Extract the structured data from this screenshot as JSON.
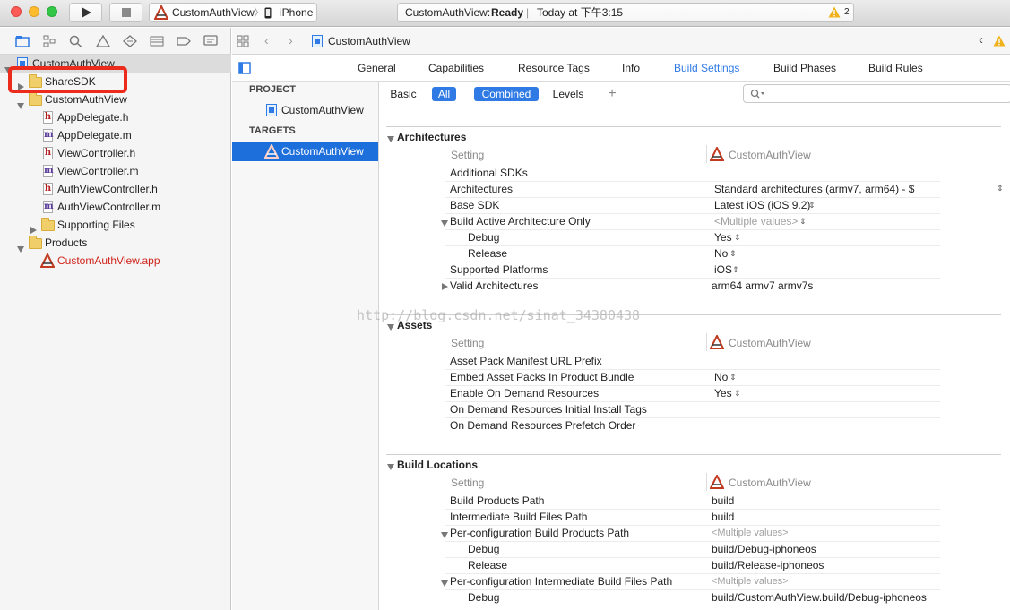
{
  "toolbar": {
    "scheme_name": "CustomAuthView",
    "device": "iPhone",
    "activity_project": "CustomAuthView:",
    "activity_status": "Ready",
    "activity_separator": "|",
    "activity_time": "Today at 下午3:15",
    "warning_count": "2"
  },
  "navigator": {
    "items": [
      {
        "label": "CustomAuthView"
      },
      {
        "label": "ShareSDK"
      },
      {
        "label": "CustomAuthView"
      },
      {
        "label": "AppDelegate.h",
        "type": "h"
      },
      {
        "label": "AppDelegate.m",
        "type": "m"
      },
      {
        "label": "ViewController.h",
        "type": "h"
      },
      {
        "label": "ViewController.m",
        "type": "m"
      },
      {
        "label": "AuthViewController.h",
        "type": "h"
      },
      {
        "label": "AuthViewController.m",
        "type": "m"
      },
      {
        "label": "Supporting Files"
      },
      {
        "label": "Products"
      },
      {
        "label": "CustomAuthView.app"
      }
    ]
  },
  "jumpbar": {
    "file": "CustomAuthView"
  },
  "project_tabs": [
    "General",
    "Capabilities",
    "Resource Tags",
    "Info",
    "Build Settings",
    "Build Phases",
    "Build Rules"
  ],
  "targets_pane": {
    "project_header": "PROJECT",
    "project_item": "CustomAuthView",
    "targets_header": "TARGETS",
    "target_item": "CustomAuthView"
  },
  "filter": {
    "basic": "Basic",
    "all": "All",
    "combined": "Combined",
    "levels": "Levels",
    "add": "+"
  },
  "sections": {
    "architectures": {
      "title": "Architectures",
      "col_setting": "Setting",
      "col_target": "CustomAuthView",
      "rows": [
        {
          "name": "Additional SDKs",
          "value": ""
        },
        {
          "name": "Architectures",
          "value": "Standard architectures (armv7, arm64)  -  $"
        },
        {
          "name": "Base SDK",
          "value": "Latest iOS (iOS 9.2)"
        },
        {
          "name": "Build Active Architecture Only",
          "value": "<Multiple values>"
        },
        {
          "name": "Debug",
          "value": "Yes"
        },
        {
          "name": "Release",
          "value": "No"
        },
        {
          "name": "Supported Platforms",
          "value": "iOS"
        },
        {
          "name": "Valid Architectures",
          "value": "arm64 armv7 armv7s"
        }
      ]
    },
    "assets": {
      "title": "Assets",
      "col_setting": "Setting",
      "col_target": "CustomAuthView",
      "rows": [
        {
          "name": "Asset Pack Manifest URL Prefix",
          "value": ""
        },
        {
          "name": "Embed Asset Packs In Product Bundle",
          "value": "No"
        },
        {
          "name": "Enable On Demand Resources",
          "value": "Yes"
        },
        {
          "name": "On Demand Resources Initial Install Tags",
          "value": ""
        },
        {
          "name": "On Demand Resources Prefetch Order",
          "value": ""
        }
      ]
    },
    "build_locations": {
      "title": "Build Locations",
      "col_setting": "Setting",
      "col_target": "CustomAuthView",
      "rows": [
        {
          "name": "Build Products Path",
          "value": "build"
        },
        {
          "name": "Intermediate Build Files Path",
          "value": "build"
        },
        {
          "name": "Per-configuration Build Products Path",
          "value": "<Multiple values>"
        },
        {
          "name": "Debug",
          "value": "build/Debug-iphoneos"
        },
        {
          "name": "Release",
          "value": "build/Release-iphoneos"
        },
        {
          "name": "Per-configuration Intermediate Build Files Path",
          "value": "<Multiple values>"
        },
        {
          "name": "Debug",
          "value": "build/CustomAuthView.build/Debug-iphoneos"
        }
      ]
    }
  },
  "watermark": "http://blog.csdn.net/sinat_34380438",
  "colors": {
    "accent": "#2f7ae5",
    "selection": "#1d6fdc",
    "highlight_box": "#ec2b1d",
    "product_red": "#d0231b",
    "folder": "#f0cf6b"
  }
}
